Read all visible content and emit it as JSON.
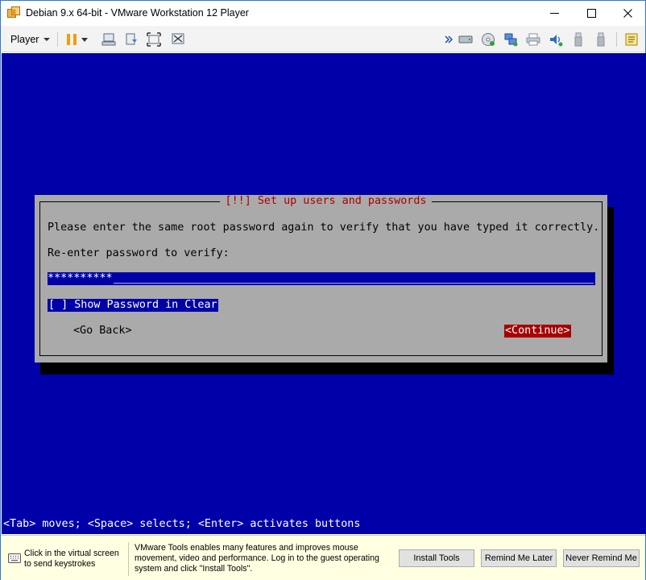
{
  "window": {
    "title": "Debian 9.x 64-bit - VMware Workstation 12 Player",
    "accent": "#2b79d6"
  },
  "toolbar": {
    "player_label": "Player",
    "left_icons": [
      "pause-icon",
      "dropdown-arrow-icon",
      "send-ctrl-alt-del-icon",
      "unity-icon",
      "full-screen-icon",
      "disable-unity-icon"
    ],
    "right_icons": [
      "more-devices-icon",
      "hard-disk-icon",
      "cd-dvd-icon",
      "network-adapter-icon",
      "printer-icon",
      "sound-card-icon",
      "usb-device-icon",
      "usb-device-2-icon",
      "message-log-icon"
    ]
  },
  "installer": {
    "dialog_title": "[!!] Set up users and passwords",
    "message": "Please enter the same root password again to verify that you have typed it correctly.",
    "field_label": "Re-enter password to verify:",
    "password_value": "**********",
    "checkbox_label": "[ ] Show Password in Clear",
    "back_button": "<Go Back>",
    "continue_button": "<Continue>",
    "help_line": "<Tab> moves; <Space> selects; <Enter> activates buttons",
    "colors": {
      "screen": "#0000a8",
      "dialog": "#aaaaaa",
      "title": "#a80000",
      "focus": "#a80000"
    }
  },
  "notification": {
    "keyboard_hint": "Click in the virtual screen to send keystrokes",
    "tools_message": "VMware Tools enables many features and improves mouse movement, video and performance. Log in to the guest operating system and click \"Install Tools\".",
    "buttons": {
      "install": "Install Tools",
      "remind": "Remind Me Later",
      "never": "Never Remind Me"
    }
  }
}
